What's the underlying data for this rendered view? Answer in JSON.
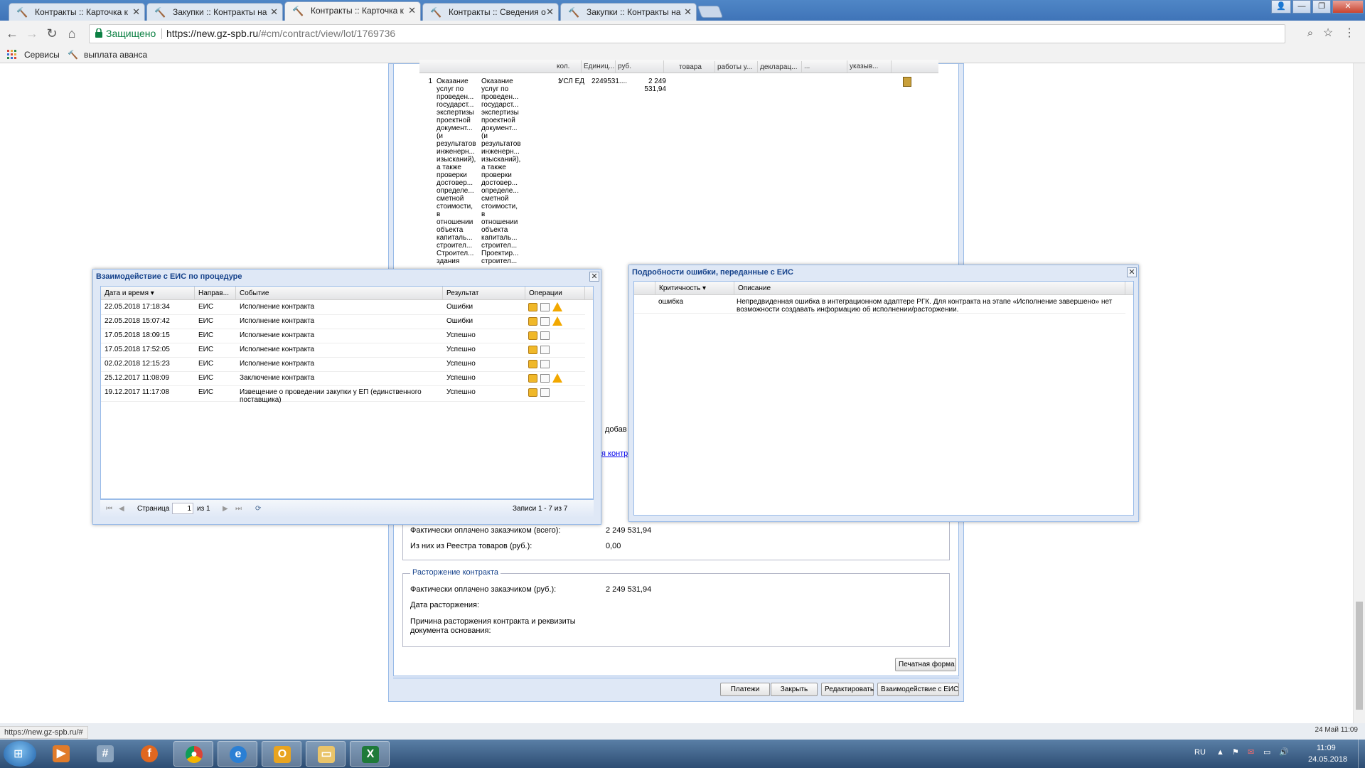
{
  "browser": {
    "tabs": [
      {
        "label": "Контракты :: Карточка к"
      },
      {
        "label": "Закупки :: Контракты на"
      },
      {
        "label": "Контракты :: Карточка к"
      },
      {
        "label": "Контракты :: Сведения о"
      },
      {
        "label": "Закупки :: Контракты на"
      }
    ],
    "secure_label": "Защищено",
    "url_host": "https://new.gz-spb.ru",
    "url_path": "/#cm/contract/view/lot/1769736",
    "bookmarks": [
      "Сервисы",
      "выплата аванса"
    ]
  },
  "contract_grid": {
    "headers": [
      "кол.",
      "Единиц...",
      "руб.",
      "товара",
      "работы у...",
      "декларац...",
      "...",
      "указыв..."
    ],
    "row": {
      "num": "1",
      "name1": "Оказание\nуслуг по\nпроведен...\nгосударст...\nэкспертизы\nпроектной\nдокумент...\n(и\nрезультатов\nинженерн...\nизысканий),\nа также\nпроверки\nдостовер...\nопределе...\nсметной\nстоимости,\nв\nотношении\nобъекта\nкапиталь...\nстроител...\nСтроител...\nздания",
      "name2": "Оказание\nуслуг по\nпроведен...\nгосударст...\nэкспертизы\nпроектной\nдокумент...\n(и\nрезультатов\nинженерн...\nизысканий),\nа также\nпроверки\nдостовер...\nопределе...\nсметной\nстоимости,\nв\nотношении\nобъекта\nкапиталь...\nстроител...\nПроектир...\nстроител...",
      "qty": "1",
      "unit": "УСЛ ЕД",
      "code": "2249531....",
      "sum": "2 249\n531,94"
    }
  },
  "partial": {
    "add_text": "добав",
    "link_text": "я контр"
  },
  "execution": {
    "paid_label": "Фактически оплачено заказчиком (всего):",
    "paid_value": "2 249 531,94",
    "registry_label": "Из них из Реестра товаров (руб.):",
    "registry_value": "0,00"
  },
  "termination": {
    "legend": "Расторжение контракта",
    "paid_label": "Фактически оплачено заказчиком (руб.):",
    "paid_value": "2 249 531,94",
    "date_label": "Дата расторжения:",
    "reason_label": "Причина расторжения контракта и реквизиты\nдокумента основания:"
  },
  "buttons": {
    "print": "Печатная форма",
    "payments": "Платежи",
    "close": "Закрыть",
    "edit": "Редактировать",
    "eis": "Взаимодействие с ЕИС"
  },
  "eis_dialog": {
    "title": "Взаимодействие с ЕИС по процедуре",
    "columns": [
      "Дата и время",
      "Направ...",
      "Событие",
      "Результат",
      "Операции"
    ],
    "rows": [
      {
        "date": "22.05.2018 17:18:34",
        "dir": "ЕИС",
        "event": "Исполнение контракта",
        "result": "Ошибки",
        "warn": true
      },
      {
        "date": "22.05.2018 15:07:42",
        "dir": "ЕИС",
        "event": "Исполнение контракта",
        "result": "Ошибки",
        "warn": true
      },
      {
        "date": "17.05.2018 18:09:15",
        "dir": "ЕИС",
        "event": "Исполнение контракта",
        "result": "Успешно",
        "warn": false
      },
      {
        "date": "17.05.2018 17:52:05",
        "dir": "ЕИС",
        "event": "Исполнение контракта",
        "result": "Успешно",
        "warn": false
      },
      {
        "date": "02.02.2018 12:15:23",
        "dir": "ЕИС",
        "event": "Исполнение контракта",
        "result": "Успешно",
        "warn": false
      },
      {
        "date": "25.12.2017 11:08:09",
        "dir": "ЕИС",
        "event": "Заключение контракта",
        "result": "Успешно",
        "warn": true
      },
      {
        "date": "19.12.2017 11:17:08",
        "dir": "ЕИС",
        "event": "Извещение о проведении закупки у ЕП (единственного\nпоставщика)",
        "result": "Успешно",
        "warn": false
      }
    ],
    "pager": {
      "page_label": "Страница",
      "page_value": "1",
      "of_label": "из 1",
      "records": "Записи 1 - 7 из 7"
    }
  },
  "error_dialog": {
    "title": "Подробности ошибки, переданные с ЕИС",
    "columns": [
      "Критичность",
      "Описание"
    ],
    "rows": [
      {
        "severity": "ошибка",
        "description": "Непредвиденная ошибка в интеграционном адаптере РГК. Для контракта на этапе «Исполнение завершено» нет\nвозможности создавать информацию об исполнении/расторжении."
      }
    ]
  },
  "status_url": "https://new.gz-spb.ru/#",
  "date_strip": "24 Май 11:09",
  "taskbar": {
    "lang": "RU",
    "time": "11:09",
    "date": "24.05.2018"
  }
}
